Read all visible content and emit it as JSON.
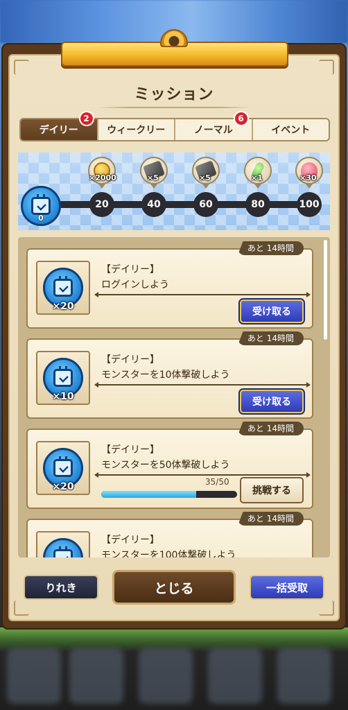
{
  "title": "ミッション",
  "tabs": [
    {
      "label": "デイリー",
      "badge": "2",
      "active": true
    },
    {
      "label": "ウィークリー",
      "badge": "",
      "active": false
    },
    {
      "label": "ノーマル",
      "badge": "6",
      "active": false
    },
    {
      "label": "イベント",
      "badge": "",
      "active": false
    }
  ],
  "progress": {
    "current_points": "0",
    "milestones": [
      "20",
      "40",
      "60",
      "80",
      "100"
    ],
    "rewards": [
      {
        "icon": "gold-coin-icon",
        "qty": "×2000"
      },
      {
        "icon": "dark-weapon-icon",
        "qty": "×5"
      },
      {
        "icon": "dark-weapon-icon",
        "qty": "×5"
      },
      {
        "icon": "green-herb-icon",
        "qty": "×1"
      },
      {
        "icon": "pink-gem-icon",
        "qty": "×30"
      }
    ]
  },
  "missions": [
    {
      "time": "あと 14時間",
      "category": "【デイリー】",
      "text": "ログインしよう",
      "reward_qty": "×20",
      "action": "受け取る"
    },
    {
      "time": "あと 14時間",
      "category": "【デイリー】",
      "text": "モンスターを10体撃破しよう",
      "reward_qty": "×10",
      "action": "受け取る"
    },
    {
      "time": "あと 14時間",
      "category": "【デイリー】",
      "text": "モンスターを50体撃破しよう",
      "reward_qty": "×20",
      "action": "挑戦する",
      "progress_text": "35/50",
      "progress": 0.7
    },
    {
      "time": "あと 14時間",
      "category": "【デイリー】",
      "text": "モンスターを100体撃破しよう",
      "reward_qty": "",
      "action": ""
    }
  ],
  "footer": {
    "history_label": "りれき",
    "close_label": "とじる",
    "claim_all_label": "一括受取"
  },
  "colors": {
    "frame": "#5a3a1c",
    "parchment": "#efe2c4",
    "accent_blue": "#2e3bb8",
    "badge_red": "#d8242c"
  }
}
